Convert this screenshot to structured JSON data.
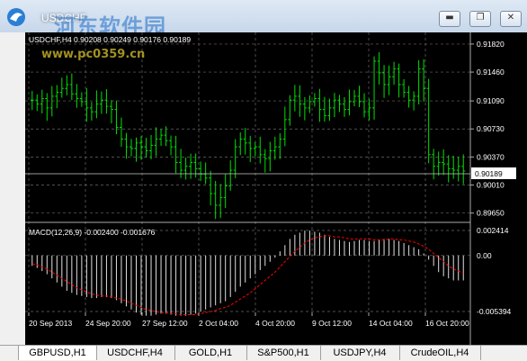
{
  "window": {
    "title": "USDCHF",
    "watermark_cn": "河东软件园",
    "watermark_url": "www.pc0359.cn"
  },
  "chart": {
    "header": "USDCHF,H4 0.90208 0.90249 0.90176 0.90189",
    "price_axis": [
      "0.91820",
      "0.91460",
      "0.91090",
      "0.90730",
      "0.90370",
      "0.90010",
      "0.89650"
    ],
    "current_price": "0.90189",
    "macd_label": "MACD(12,26,9) -0.002400 -0.001676",
    "macd_axis": [
      "0.002414",
      "0.00",
      "-0.005394"
    ],
    "time_axis": [
      "20 Sep 2013",
      "24 Sep 20:00",
      "27 Sep 12:00",
      "2 Oct 04:00",
      "4 Oct 20:00",
      "9 Oct 12:00",
      "14 Oct 04:00",
      "16 Oct 20:00"
    ],
    "colors": {
      "candles": "#00e000",
      "grid": "#777777",
      "signal": "#ff0000",
      "histogram": "#e0e0e0",
      "background": "#000000"
    }
  },
  "chart_data": {
    "type": "ohlc",
    "symbol": "USDCHF",
    "timeframe": "H4",
    "ylim": [
      0.896,
      0.919
    ],
    "closes": [
      0.911,
      0.9105,
      0.9112,
      0.91,
      0.9115,
      0.912,
      0.9125,
      0.913,
      0.9118,
      0.9112,
      0.9108,
      0.91,
      0.9095,
      0.9105,
      0.911,
      0.9102,
      0.9098,
      0.9075,
      0.906,
      0.905,
      0.9048,
      0.9055,
      0.905,
      0.9045,
      0.9052,
      0.906,
      0.9065,
      0.9058,
      0.905,
      0.903,
      0.902,
      0.9025,
      0.903,
      0.9022,
      0.9015,
      0.901,
      0.899,
      0.8975,
      0.8985,
      0.9,
      0.902,
      0.905,
      0.906,
      0.9055,
      0.9048,
      0.905,
      0.904,
      0.9035,
      0.9045,
      0.905,
      0.906,
      0.9085,
      0.911,
      0.9115,
      0.9105,
      0.91,
      0.9108,
      0.9112,
      0.9098,
      0.909,
      0.91,
      0.911,
      0.9105,
      0.9098,
      0.9108,
      0.9115,
      0.9108,
      0.9095,
      0.91,
      0.916,
      0.9145,
      0.913,
      0.914,
      0.915,
      0.913,
      0.912,
      0.911,
      0.9115,
      0.915,
      0.9125,
      0.904,
      0.9025,
      0.903,
      0.9028,
      0.9022,
      0.902,
      0.9025,
      0.9019
    ],
    "macd_histogram": [
      -0.001,
      -0.0012,
      -0.0015,
      -0.0018,
      -0.0022,
      -0.0026,
      -0.003,
      -0.0034,
      -0.0036,
      -0.0038,
      -0.0039,
      -0.004,
      -0.0041,
      -0.0041,
      -0.004,
      -0.004,
      -0.0041,
      -0.0043,
      -0.0046,
      -0.0049,
      -0.0052,
      -0.0055,
      -0.0057,
      -0.0058,
      -0.0058,
      -0.0057,
      -0.0056,
      -0.0056,
      -0.0057,
      -0.0058,
      -0.0058,
      -0.0058,
      -0.0057,
      -0.0056,
      -0.0054,
      -0.0052,
      -0.005,
      -0.0048,
      -0.0046,
      -0.0044,
      -0.004,
      -0.0035,
      -0.003,
      -0.0026,
      -0.0022,
      -0.0018,
      -0.0014,
      -0.001,
      -0.0006,
      -0.0002,
      0.0004,
      0.001,
      0.0016,
      0.002,
      0.0022,
      0.0024,
      0.0024,
      0.0023,
      0.0022,
      0.002,
      0.0018,
      0.0016,
      0.0015,
      0.0014,
      0.0013,
      0.0014,
      0.0015,
      0.0015,
      0.0014,
      0.0014,
      0.0015,
      0.0016,
      0.0016,
      0.0015,
      0.0014,
      0.0012,
      0.001,
      0.0008,
      0.0006,
      0.0002,
      -0.0004,
      -0.001,
      -0.0016,
      -0.002,
      -0.0022,
      -0.0024,
      -0.0024,
      -0.0024
    ],
    "macd_signal": [
      -0.0008,
      -0.0009,
      -0.0011,
      -0.0013,
      -0.0016,
      -0.0019,
      -0.0022,
      -0.0025,
      -0.0028,
      -0.0031,
      -0.0033,
      -0.0035,
      -0.0037,
      -0.0038,
      -0.0039,
      -0.0039,
      -0.004,
      -0.0041,
      -0.0042,
      -0.0044,
      -0.0046,
      -0.0048,
      -0.005,
      -0.0052,
      -0.0053,
      -0.0054,
      -0.0055,
      -0.0055,
      -0.0056,
      -0.0056,
      -0.0057,
      -0.0057,
      -0.0057,
      -0.0057,
      -0.0056,
      -0.0055,
      -0.0054,
      -0.0053,
      -0.0051,
      -0.005,
      -0.0048,
      -0.0045,
      -0.0042,
      -0.0039,
      -0.0036,
      -0.0032,
      -0.0028,
      -0.0024,
      -0.002,
      -0.0016,
      -0.0011,
      -0.0006,
      -0.0001,
      0.0004,
      0.0008,
      0.0012,
      0.0015,
      0.0017,
      0.0018,
      0.0019,
      0.0019,
      0.0018,
      0.0018,
      0.0017,
      0.0016,
      0.0016,
      0.0016,
      0.0016,
      0.0016,
      0.0015,
      0.0015,
      0.0015,
      0.0016,
      0.0016,
      0.0015,
      0.0015,
      0.0014,
      0.0013,
      0.0011,
      0.0009,
      0.0006,
      0.0002,
      -0.0002,
      -0.0006,
      -0.001,
      -0.0013,
      -0.0015,
      -0.0017
    ]
  },
  "tabs": [
    {
      "label": "GBPUSD,H1",
      "active": true
    },
    {
      "label": "USDCHF,H4",
      "active": false
    },
    {
      "label": "GOLD,H1",
      "active": false
    },
    {
      "label": "S&P500,H1",
      "active": false
    },
    {
      "label": "USDJPY,H4",
      "active": false
    },
    {
      "label": "CrudeOIL,H4",
      "active": false
    }
  ]
}
